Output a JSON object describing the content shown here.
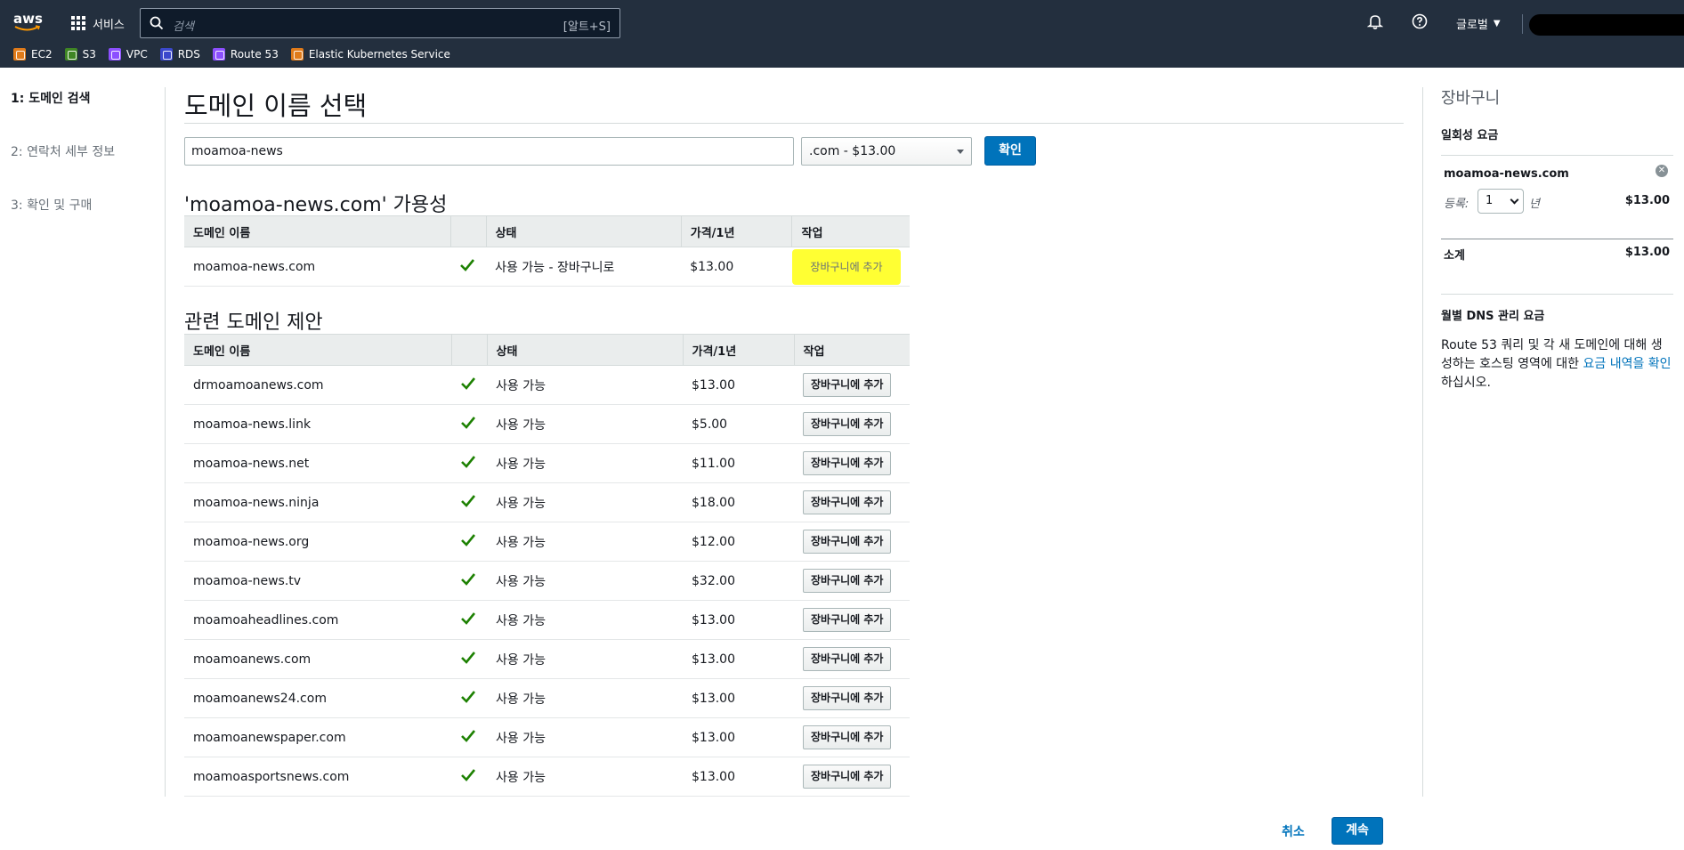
{
  "nav": {
    "logo": "aws",
    "services": "서비스",
    "search_placeholder": "검색",
    "search_shortcut": "[알트+S]",
    "region": "글로벌",
    "favorites": [
      {
        "label": "EC2",
        "color": "#e07b1a",
        "icon": "ec2-icon"
      },
      {
        "label": "S3",
        "color": "#3f8624",
        "icon": "s3-icon"
      },
      {
        "label": "VPC",
        "color": "#8c4fff",
        "icon": "vpc-icon"
      },
      {
        "label": "RDS",
        "color": "#3b48cc",
        "icon": "rds-icon"
      },
      {
        "label": "Route 53",
        "color": "#8c4fff",
        "icon": "route53-icon"
      },
      {
        "label": "Elastic Kubernetes Service",
        "color": "#e07b1a",
        "icon": "eks-icon"
      }
    ]
  },
  "wizard": {
    "steps": [
      "1: 도메인 검색",
      "2: 연락처 세부 정보",
      "3: 확인 및 구매"
    ]
  },
  "main": {
    "title": "도메인 이름 선택",
    "search_value": "moamoa-news",
    "tld_selected": ".com - $13.00",
    "check_button": "확인",
    "availability_title": "'moamoa-news.com' 가용성",
    "related_title": "관련 도메인 제안",
    "columns": [
      "도메인 이름",
      "",
      "상태",
      "가격/1년",
      "작업"
    ],
    "availability_row": {
      "name": "moamoa-news.com",
      "status": "사용 가능 - 장바구니로",
      "price": "$13.00",
      "action": "장바구니에 추가"
    },
    "related_rows": [
      {
        "name": "drmoamoanews.com",
        "status": "사용 가능",
        "price": "$13.00",
        "action": "장바구니에 추가"
      },
      {
        "name": "moamoa-news.link",
        "status": "사용 가능",
        "price": "$5.00",
        "action": "장바구니에 추가"
      },
      {
        "name": "moamoa-news.net",
        "status": "사용 가능",
        "price": "$11.00",
        "action": "장바구니에 추가"
      },
      {
        "name": "moamoa-news.ninja",
        "status": "사용 가능",
        "price": "$18.00",
        "action": "장바구니에 추가"
      },
      {
        "name": "moamoa-news.org",
        "status": "사용 가능",
        "price": "$12.00",
        "action": "장바구니에 추가"
      },
      {
        "name": "moamoa-news.tv",
        "status": "사용 가능",
        "price": "$32.00",
        "action": "장바구니에 추가"
      },
      {
        "name": "moamoaheadlines.com",
        "status": "사용 가능",
        "price": "$13.00",
        "action": "장바구니에 추가"
      },
      {
        "name": "moamoanews.com",
        "status": "사용 가능",
        "price": "$13.00",
        "action": "장바구니에 추가"
      },
      {
        "name": "moamoanews24.com",
        "status": "사용 가능",
        "price": "$13.00",
        "action": "장바구니에 추가"
      },
      {
        "name": "moamoanewspaper.com",
        "status": "사용 가능",
        "price": "$13.00",
        "action": "장바구니에 추가"
      },
      {
        "name": "moamoasportsnews.com",
        "status": "사용 가능",
        "price": "$13.00",
        "action": "장바구니에 추가"
      }
    ],
    "cancel": "취소",
    "continue": "계속"
  },
  "cart": {
    "title": "장바구니",
    "one_time": "일회성 요금",
    "domain": "moamoa-news.com",
    "register_label": "등록:",
    "years": "1",
    "year_unit": "년",
    "domain_price": "$13.00",
    "subtotal_label": "소계",
    "subtotal": "$13.00",
    "dns_title": "월별 DNS 관리 요금",
    "dns_text_before": "Route 53 쿼리 및 각 새 도메인에 대해 생성하는 호스팅 영역에 대한 ",
    "dns_link": "요금 내역을 확인",
    "dns_text_after": "하십시오."
  },
  "colors": {
    "nav_bg": "#232f3e",
    "primary": "#0073bb",
    "success": "#1d8102",
    "highlight": "#ffff33"
  }
}
